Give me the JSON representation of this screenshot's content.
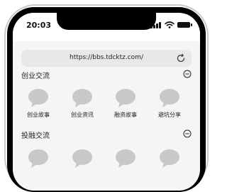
{
  "status_bar": {
    "time": "20:03"
  },
  "browser": {
    "url": "https://bbs.tdcktz.com/"
  },
  "sections": [
    {
      "title": "创业交流",
      "items": [
        {
          "label": "创业故事"
        },
        {
          "label": "创业资讯"
        },
        {
          "label": "融资故事"
        },
        {
          "label": "避坑分享"
        }
      ]
    },
    {
      "title": "投融交流",
      "items": [
        {
          "label": ""
        },
        {
          "label": ""
        },
        {
          "label": ""
        },
        {
          "label": ""
        }
      ]
    }
  ],
  "colors": {
    "page_bg": "#f5f5f7",
    "url_bar_bg": "#e8e8ea",
    "icon_placeholder": "#c8c8c8",
    "text": "#222222"
  },
  "icons": {
    "status": [
      "signal-icon",
      "wifi-icon",
      "battery-icon"
    ],
    "browser": "reload-icon",
    "section": "collapse-icon",
    "item": "chat-bubble-icon"
  }
}
